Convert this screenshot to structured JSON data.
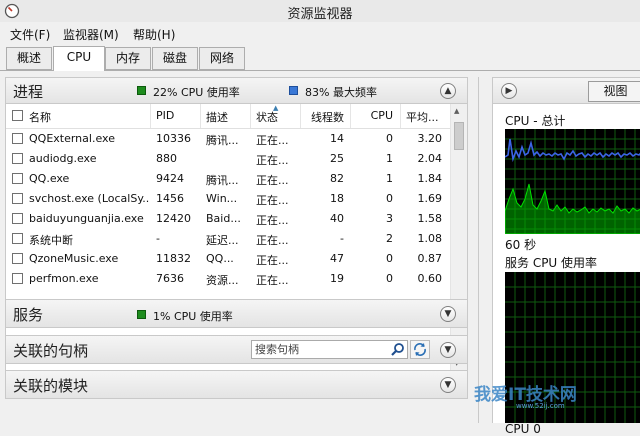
{
  "window": {
    "title": "资源监视器"
  },
  "menu": [
    {
      "label": "文件(F)"
    },
    {
      "label": "监视器(M)"
    },
    {
      "label": "帮助(H)"
    }
  ],
  "tabs": [
    {
      "label": "概述"
    },
    {
      "label": "CPU",
      "active": true
    },
    {
      "label": "内存"
    },
    {
      "label": "磁盘"
    },
    {
      "label": "网络"
    }
  ],
  "processes": {
    "title": "进程",
    "cpu_usage": "22% CPU 使用率",
    "max_freq": "83% 最大频率",
    "columns": [
      "名称",
      "PID",
      "描述",
      "状态",
      "线程数",
      "CPU",
      "平均..."
    ],
    "rows": [
      {
        "name": "QQExternal.exe",
        "pid": "10336",
        "desc": "腾讯...",
        "status": "正在...",
        "threads": "14",
        "cpu": "0",
        "avg": "3.20"
      },
      {
        "name": "audiodg.exe",
        "pid": "880",
        "desc": "",
        "status": "正在...",
        "threads": "25",
        "cpu": "1",
        "avg": "2.04"
      },
      {
        "name": "QQ.exe",
        "pid": "9424",
        "desc": "腾讯...",
        "status": "正在...",
        "threads": "82",
        "cpu": "1",
        "avg": "1.84"
      },
      {
        "name": "svchost.exe (LocalSy...",
        "pid": "1456",
        "desc": "Win...",
        "status": "正在...",
        "threads": "18",
        "cpu": "0",
        "avg": "1.69"
      },
      {
        "name": "baiduyunguanjia.exe",
        "pid": "12420",
        "desc": "Baid...",
        "status": "正在...",
        "threads": "40",
        "cpu": "3",
        "avg": "1.58"
      },
      {
        "name": "系统中断",
        "pid": "-",
        "desc": "延迟...",
        "status": "正在...",
        "threads": "-",
        "cpu": "2",
        "avg": "1.08"
      },
      {
        "name": "QzoneMusic.exe",
        "pid": "11832",
        "desc": "QQ...",
        "status": "正在...",
        "threads": "47",
        "cpu": "0",
        "avg": "0.87"
      },
      {
        "name": "perfmon.exe",
        "pid": "7636",
        "desc": "资源...",
        "status": "正在...",
        "threads": "19",
        "cpu": "0",
        "avg": "0.60"
      }
    ]
  },
  "services": {
    "title": "服务",
    "cpu_usage": "1% CPU 使用率"
  },
  "handles": {
    "title": "关联的句柄",
    "search_placeholder": "搜索句柄"
  },
  "modules": {
    "title": "关联的模块"
  },
  "right_pane": {
    "view_label": "视图",
    "cpu_total_label": "CPU - 总计",
    "time_label": "60 秒",
    "service_cpu_label": "服务 CPU 使用率",
    "cpu0_label": "CPU 0"
  },
  "watermark": {
    "text": "我爱IT技术网",
    "sub": "www.52ij.com"
  },
  "colors": {
    "cpu_usage_green": "#1e8c1e",
    "max_freq_blue": "#3a78d6",
    "graph_green": "#00c000",
    "graph_blue": "#3c64e6"
  }
}
